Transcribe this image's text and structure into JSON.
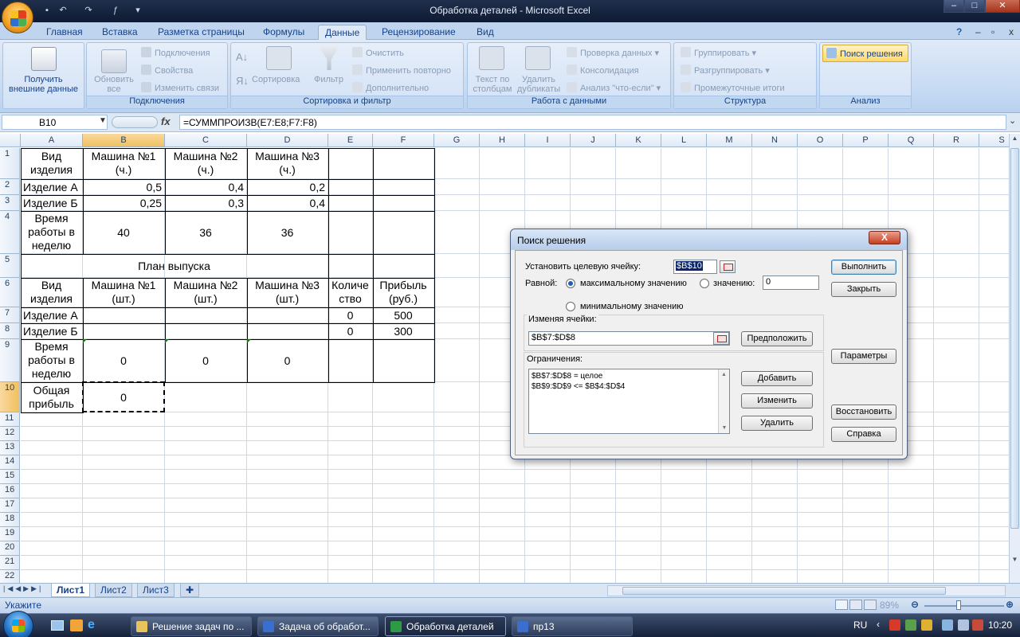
{
  "window": {
    "title": "Обработка деталей - Microsoft Excel"
  },
  "tabs": [
    "Главная",
    "Вставка",
    "Разметка страницы",
    "Формулы",
    "Данные",
    "Рецензирование",
    "Вид"
  ],
  "active_tab": "Данные",
  "ribbon": {
    "get_external": {
      "line1": "Получить",
      "line2": "внешние данные"
    },
    "refresh": {
      "line1": "Обновить",
      "line2": "все"
    },
    "connections": {
      "c1": "Подключения",
      "c2": "Свойства",
      "c3": "Изменить связи",
      "label": "Подключения"
    },
    "sort": {
      "sort_label": "Сортировка",
      "filter_label": "Фильтр",
      "clear": "Очистить",
      "reapply": "Применить повторно",
      "advanced": "Дополнительно",
      "label": "Сортировка и фильтр"
    },
    "data_tools": {
      "text_cols_1": "Текст по",
      "text_cols_2": "столбцам",
      "remove_dup_1": "Удалить",
      "remove_dup_2": "дубликаты",
      "validation": "Проверка данных",
      "consolidate": "Консолидация",
      "whatif": "Анализ \"что-если\"",
      "label": "Работа с данными"
    },
    "outline": {
      "group": "Группировать",
      "ungroup": "Разгруппировать",
      "subtotal": "Промежуточные итоги",
      "label": "Структура"
    },
    "analysis": {
      "solver": "Поиск решения",
      "label": "Анализ"
    }
  },
  "formula_bar": {
    "name_box": "B10",
    "fx": "fx",
    "formula": "=СУММПРОИЗВ(E7:E8;F7:F8)"
  },
  "columns": [
    "A",
    "B",
    "C",
    "D",
    "E",
    "F",
    "G",
    "H",
    "I",
    "J",
    "K",
    "L",
    "M",
    "N",
    "O",
    "P",
    "Q",
    "R",
    "S"
  ],
  "rows": [
    "1",
    "2",
    "3",
    "4",
    "5",
    "6",
    "7",
    "8",
    "9",
    "10",
    "11",
    "12",
    "13",
    "14",
    "15",
    "16",
    "17",
    "18",
    "19",
    "20",
    "21",
    "22"
  ],
  "cells": {
    "a1": "Вид изделия",
    "b1": "Машина №1 (ч.)",
    "c1": "Машина №2 (ч.)",
    "d1": "Машина №3 (ч.)",
    "a2": "Изделие А",
    "b2": "0,5",
    "c2": "0,4",
    "d2": "0,2",
    "a3": "Изделие Б",
    "b3": "0,25",
    "c3": "0,3",
    "d3": "0,4",
    "a4": "Время работы в неделю",
    "b4": "40",
    "c4": "36",
    "d4": "36",
    "a5": "План выпуска",
    "a6": "Вид изделия",
    "b6": "Машина №1 (шт.)",
    "c6": "Машина №2 (шт.)",
    "d6": "Машина №3 (шт.)",
    "e6": "Количе ство",
    "f6": "Прибыль (руб.)",
    "a7": "Изделие А",
    "e7": "0",
    "f7": "500",
    "a8": "Изделие Б",
    "e8": "0",
    "f8": "300",
    "a9": "Время работы в неделю",
    "b9": "0",
    "c9": "0",
    "d9": "0",
    "a10": "Общая прибыль",
    "b10": "0"
  },
  "sheets": [
    "Лист1",
    "Лист2",
    "Лист3"
  ],
  "status": {
    "mode": "Укажите",
    "zoom": "89%"
  },
  "dialog": {
    "title": "Поиск решения",
    "target_label": "Установить целевую ячейку:",
    "target_value": "$B$10",
    "equal_label": "Равной:",
    "opt_max": "максимальному значению",
    "opt_value": "значению:",
    "value_input": "0",
    "opt_min": "минимальному значению",
    "changing_label": "Изменяя ячейки:",
    "changing_value": "$B$7:$D$8",
    "guess": "Предположить",
    "constraints_label": "Ограничения:",
    "constraints": [
      "$B$7:$D$8 = целое",
      "$B$9:$D$9 <= $B$4:$D$4"
    ],
    "btn_solve": "Выполнить",
    "btn_close": "Закрыть",
    "btn_options": "Параметры",
    "btn_add": "Добавить",
    "btn_change": "Изменить",
    "btn_delete": "Удалить",
    "btn_reset": "Восстановить",
    "btn_help": "Справка",
    "close_x": "X"
  },
  "taskbar": {
    "items": [
      "Решение задач по ...",
      "Задача об обработ...",
      "Обработка деталей",
      "пр13"
    ],
    "lang": "RU",
    "clock": "10:20"
  }
}
